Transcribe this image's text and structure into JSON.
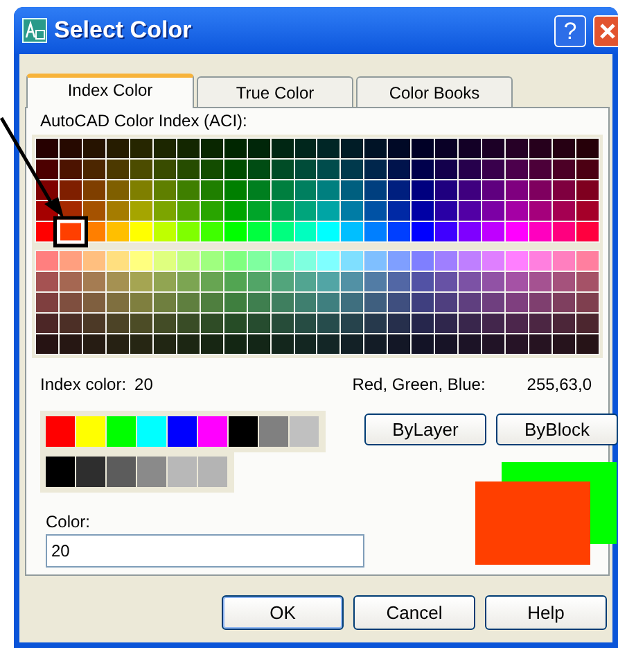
{
  "window": {
    "title": "Select Color",
    "help_button": "?"
  },
  "tabs": [
    {
      "label": "Index Color",
      "selected": true
    },
    {
      "label": "True Color",
      "selected": false
    },
    {
      "label": "Color Books",
      "selected": false
    }
  ],
  "aci_label": "AutoCAD Color Index (ACI):",
  "upper_rows": [
    {
      "swatches": [
        {
          "color": "#260000",
          "selected": false
        },
        {
          "color": "#260900",
          "selected": false
        },
        {
          "color": "#261300",
          "selected": false
        },
        {
          "color": "#261c00",
          "selected": false
        },
        {
          "color": "#262600",
          "selected": false
        },
        {
          "color": "#1c2600",
          "selected": false
        },
        {
          "color": "#132600",
          "selected": false
        },
        {
          "color": "#092600",
          "selected": false
        },
        {
          "color": "#002600",
          "selected": false
        },
        {
          "color": "#002609",
          "selected": false
        },
        {
          "color": "#002613",
          "selected": false
        },
        {
          "color": "#00261c",
          "selected": false
        },
        {
          "color": "#002626",
          "selected": false
        },
        {
          "color": "#001c26",
          "selected": false
        },
        {
          "color": "#001326",
          "selected": false
        },
        {
          "color": "#000926",
          "selected": false
        },
        {
          "color": "#000026",
          "selected": false
        },
        {
          "color": "#090026",
          "selected": false
        },
        {
          "color": "#130026",
          "selected": false
        },
        {
          "color": "#1c0026",
          "selected": false
        },
        {
          "color": "#260026",
          "selected": false
        },
        {
          "color": "#26001c",
          "selected": false
        },
        {
          "color": "#260013",
          "selected": false
        },
        {
          "color": "#260009",
          "selected": false
        }
      ]
    },
    {
      "swatches": [
        {
          "color": "#4c0000",
          "selected": false
        },
        {
          "color": "#4c1300",
          "selected": false
        },
        {
          "color": "#4c2600",
          "selected": false
        },
        {
          "color": "#4c3900",
          "selected": false
        },
        {
          "color": "#4c4c00",
          "selected": false
        },
        {
          "color": "#394c00",
          "selected": false
        },
        {
          "color": "#264c00",
          "selected": false
        },
        {
          "color": "#134c00",
          "selected": false
        },
        {
          "color": "#004c00",
          "selected": false
        },
        {
          "color": "#004c13",
          "selected": false
        },
        {
          "color": "#004c26",
          "selected": false
        },
        {
          "color": "#004c39",
          "selected": false
        },
        {
          "color": "#004c4c",
          "selected": false
        },
        {
          "color": "#00394c",
          "selected": false
        },
        {
          "color": "#00264c",
          "selected": false
        },
        {
          "color": "#00134c",
          "selected": false
        },
        {
          "color": "#00004c",
          "selected": false
        },
        {
          "color": "#13004c",
          "selected": false
        },
        {
          "color": "#26004c",
          "selected": false
        },
        {
          "color": "#39004c",
          "selected": false
        },
        {
          "color": "#4c004c",
          "selected": false
        },
        {
          "color": "#4c0039",
          "selected": false
        },
        {
          "color": "#4c0026",
          "selected": false
        },
        {
          "color": "#4c0013",
          "selected": false
        }
      ]
    },
    {
      "swatches": [
        {
          "color": "#7f0000",
          "selected": false
        },
        {
          "color": "#7f1f00",
          "selected": false
        },
        {
          "color": "#7f3f00",
          "selected": false
        },
        {
          "color": "#7f5f00",
          "selected": false
        },
        {
          "color": "#7f7f00",
          "selected": false
        },
        {
          "color": "#5f7f00",
          "selected": false
        },
        {
          "color": "#3f7f00",
          "selected": false
        },
        {
          "color": "#1f7f00",
          "selected": false
        },
        {
          "color": "#007f00",
          "selected": false
        },
        {
          "color": "#007f1f",
          "selected": false
        },
        {
          "color": "#007f3f",
          "selected": false
        },
        {
          "color": "#007f5f",
          "selected": false
        },
        {
          "color": "#007f7f",
          "selected": false
        },
        {
          "color": "#005f7f",
          "selected": false
        },
        {
          "color": "#003f7f",
          "selected": false
        },
        {
          "color": "#001f7f",
          "selected": false
        },
        {
          "color": "#00007f",
          "selected": false
        },
        {
          "color": "#1f007f",
          "selected": false
        },
        {
          "color": "#3f007f",
          "selected": false
        },
        {
          "color": "#5f007f",
          "selected": false
        },
        {
          "color": "#7f007f",
          "selected": false
        },
        {
          "color": "#7f005f",
          "selected": false
        },
        {
          "color": "#7f003f",
          "selected": false
        },
        {
          "color": "#7f001f",
          "selected": false
        }
      ]
    },
    {
      "swatches": [
        {
          "color": "#a50000",
          "selected": false
        },
        {
          "color": "#a52900",
          "selected": false
        },
        {
          "color": "#a55200",
          "selected": false
        },
        {
          "color": "#a57c00",
          "selected": false
        },
        {
          "color": "#a5a500",
          "selected": false
        },
        {
          "color": "#7ca500",
          "selected": false
        },
        {
          "color": "#52a500",
          "selected": false
        },
        {
          "color": "#29a500",
          "selected": false
        },
        {
          "color": "#00a500",
          "selected": false
        },
        {
          "color": "#00a529",
          "selected": false
        },
        {
          "color": "#00a552",
          "selected": false
        },
        {
          "color": "#00a57c",
          "selected": false
        },
        {
          "color": "#00a5a5",
          "selected": false
        },
        {
          "color": "#007ca5",
          "selected": false
        },
        {
          "color": "#0052a5",
          "selected": false
        },
        {
          "color": "#0029a5",
          "selected": false
        },
        {
          "color": "#0000a5",
          "selected": false
        },
        {
          "color": "#2900a5",
          "selected": false
        },
        {
          "color": "#5200a5",
          "selected": false
        },
        {
          "color": "#7c00a5",
          "selected": false
        },
        {
          "color": "#a500a5",
          "selected": false
        },
        {
          "color": "#a5007c",
          "selected": false
        },
        {
          "color": "#a50052",
          "selected": false
        },
        {
          "color": "#a50029",
          "selected": false
        }
      ]
    },
    {
      "swatches": [
        {
          "color": "#ff0000",
          "selected": false
        },
        {
          "color": "#ff3f00",
          "selected": true
        },
        {
          "color": "#ff7f00",
          "selected": false
        },
        {
          "color": "#ffbf00",
          "selected": false
        },
        {
          "color": "#ffff00",
          "selected": false
        },
        {
          "color": "#bfff00",
          "selected": false
        },
        {
          "color": "#7fff00",
          "selected": false
        },
        {
          "color": "#3fff00",
          "selected": false
        },
        {
          "color": "#00ff00",
          "selected": false
        },
        {
          "color": "#00ff3f",
          "selected": false
        },
        {
          "color": "#00ff7f",
          "selected": false
        },
        {
          "color": "#00ffbf",
          "selected": false
        },
        {
          "color": "#00ffff",
          "selected": false
        },
        {
          "color": "#00bfff",
          "selected": false
        },
        {
          "color": "#007fff",
          "selected": false
        },
        {
          "color": "#003fff",
          "selected": false
        },
        {
          "color": "#0000ff",
          "selected": false
        },
        {
          "color": "#3f00ff",
          "selected": false
        },
        {
          "color": "#7f00ff",
          "selected": false
        },
        {
          "color": "#bf00ff",
          "selected": false
        },
        {
          "color": "#ff00ff",
          "selected": false
        },
        {
          "color": "#ff00bf",
          "selected": false
        },
        {
          "color": "#ff007f",
          "selected": false
        },
        {
          "color": "#ff003f",
          "selected": false
        }
      ]
    }
  ],
  "lower_rows": [
    {
      "swatches": [
        {
          "color": "#ff7f7f",
          "selected": false
        },
        {
          "color": "#ff9f7f",
          "selected": false
        },
        {
          "color": "#ffbf7f",
          "selected": false
        },
        {
          "color": "#ffdf7f",
          "selected": false
        },
        {
          "color": "#ffff7f",
          "selected": false
        },
        {
          "color": "#dfff7f",
          "selected": false
        },
        {
          "color": "#bfff7f",
          "selected": false
        },
        {
          "color": "#9fff7f",
          "selected": false
        },
        {
          "color": "#7fff7f",
          "selected": false
        },
        {
          "color": "#7fff9f",
          "selected": false
        },
        {
          "color": "#7fffbf",
          "selected": false
        },
        {
          "color": "#7fffdf",
          "selected": false
        },
        {
          "color": "#7fffff",
          "selected": false
        },
        {
          "color": "#7fdfff",
          "selected": false
        },
        {
          "color": "#7fbfff",
          "selected": false
        },
        {
          "color": "#7f9fff",
          "selected": false
        },
        {
          "color": "#7f7fff",
          "selected": false
        },
        {
          "color": "#9f7fff",
          "selected": false
        },
        {
          "color": "#bf7fff",
          "selected": false
        },
        {
          "color": "#df7fff",
          "selected": false
        },
        {
          "color": "#ff7fff",
          "selected": false
        },
        {
          "color": "#ff7fdf",
          "selected": false
        },
        {
          "color": "#ff7fbf",
          "selected": false
        },
        {
          "color": "#ff7f9f",
          "selected": false
        }
      ]
    },
    {
      "swatches": [
        {
          "color": "#a55252",
          "selected": false
        },
        {
          "color": "#a56752",
          "selected": false
        },
        {
          "color": "#a57c52",
          "selected": false
        },
        {
          "color": "#a59152",
          "selected": false
        },
        {
          "color": "#a5a552",
          "selected": false
        },
        {
          "color": "#91a552",
          "selected": false
        },
        {
          "color": "#7ca552",
          "selected": false
        },
        {
          "color": "#67a552",
          "selected": false
        },
        {
          "color": "#52a552",
          "selected": false
        },
        {
          "color": "#52a567",
          "selected": false
        },
        {
          "color": "#52a57c",
          "selected": false
        },
        {
          "color": "#52a591",
          "selected": false
        },
        {
          "color": "#52a5a5",
          "selected": false
        },
        {
          "color": "#5291a5",
          "selected": false
        },
        {
          "color": "#527ca5",
          "selected": false
        },
        {
          "color": "#5267a5",
          "selected": false
        },
        {
          "color": "#5252a5",
          "selected": false
        },
        {
          "color": "#6752a5",
          "selected": false
        },
        {
          "color": "#7c52a5",
          "selected": false
        },
        {
          "color": "#9152a5",
          "selected": false
        },
        {
          "color": "#a552a5",
          "selected": false
        },
        {
          "color": "#a55291",
          "selected": false
        },
        {
          "color": "#a5527c",
          "selected": false
        },
        {
          "color": "#a55267",
          "selected": false
        }
      ]
    },
    {
      "swatches": [
        {
          "color": "#7f3f3f",
          "selected": false
        },
        {
          "color": "#7f4f3f",
          "selected": false
        },
        {
          "color": "#7f5f3f",
          "selected": false
        },
        {
          "color": "#7f6f3f",
          "selected": false
        },
        {
          "color": "#7f7f3f",
          "selected": false
        },
        {
          "color": "#6f7f3f",
          "selected": false
        },
        {
          "color": "#5f7f3f",
          "selected": false
        },
        {
          "color": "#4f7f3f",
          "selected": false
        },
        {
          "color": "#3f7f3f",
          "selected": false
        },
        {
          "color": "#3f7f4f",
          "selected": false
        },
        {
          "color": "#3f7f5f",
          "selected": false
        },
        {
          "color": "#3f7f6f",
          "selected": false
        },
        {
          "color": "#3f7f7f",
          "selected": false
        },
        {
          "color": "#3f6f7f",
          "selected": false
        },
        {
          "color": "#3f5f7f",
          "selected": false
        },
        {
          "color": "#3f4f7f",
          "selected": false
        },
        {
          "color": "#3f3f7f",
          "selected": false
        },
        {
          "color": "#4f3f7f",
          "selected": false
        },
        {
          "color": "#5f3f7f",
          "selected": false
        },
        {
          "color": "#6f3f7f",
          "selected": false
        },
        {
          "color": "#7f3f7f",
          "selected": false
        },
        {
          "color": "#7f3f6f",
          "selected": false
        },
        {
          "color": "#7f3f5f",
          "selected": false
        },
        {
          "color": "#7f3f4f",
          "selected": false
        }
      ]
    },
    {
      "swatches": [
        {
          "color": "#4c2626",
          "selected": false
        },
        {
          "color": "#4c2f26",
          "selected": false
        },
        {
          "color": "#4c3926",
          "selected": false
        },
        {
          "color": "#4c4326",
          "selected": false
        },
        {
          "color": "#4c4c26",
          "selected": false
        },
        {
          "color": "#434c26",
          "selected": false
        },
        {
          "color": "#394c26",
          "selected": false
        },
        {
          "color": "#2f4c26",
          "selected": false
        },
        {
          "color": "#264c26",
          "selected": false
        },
        {
          "color": "#264c2f",
          "selected": false
        },
        {
          "color": "#264c39",
          "selected": false
        },
        {
          "color": "#264c43",
          "selected": false
        },
        {
          "color": "#264c4c",
          "selected": false
        },
        {
          "color": "#26434c",
          "selected": false
        },
        {
          "color": "#26394c",
          "selected": false
        },
        {
          "color": "#262f4c",
          "selected": false
        },
        {
          "color": "#26264c",
          "selected": false
        },
        {
          "color": "#2f264c",
          "selected": false
        },
        {
          "color": "#39264c",
          "selected": false
        },
        {
          "color": "#43264c",
          "selected": false
        },
        {
          "color": "#4c264c",
          "selected": false
        },
        {
          "color": "#4c2643",
          "selected": false
        },
        {
          "color": "#4c2639",
          "selected": false
        },
        {
          "color": "#4c262f",
          "selected": false
        }
      ]
    },
    {
      "swatches": [
        {
          "color": "#261313",
          "selected": false
        },
        {
          "color": "#261713",
          "selected": false
        },
        {
          "color": "#261c13",
          "selected": false
        },
        {
          "color": "#262113",
          "selected": false
        },
        {
          "color": "#262613",
          "selected": false
        },
        {
          "color": "#212613",
          "selected": false
        },
        {
          "color": "#1c2613",
          "selected": false
        },
        {
          "color": "#172613",
          "selected": false
        },
        {
          "color": "#132613",
          "selected": false
        },
        {
          "color": "#132617",
          "selected": false
        },
        {
          "color": "#13261c",
          "selected": false
        },
        {
          "color": "#132621",
          "selected": false
        },
        {
          "color": "#132626",
          "selected": false
        },
        {
          "color": "#132126",
          "selected": false
        },
        {
          "color": "#131c26",
          "selected": false
        },
        {
          "color": "#131726",
          "selected": false
        },
        {
          "color": "#131326",
          "selected": false
        },
        {
          "color": "#171326",
          "selected": false
        },
        {
          "color": "#1c1326",
          "selected": false
        },
        {
          "color": "#211326",
          "selected": false
        },
        {
          "color": "#261326",
          "selected": false
        },
        {
          "color": "#261321",
          "selected": false
        },
        {
          "color": "#26131c",
          "selected": false
        },
        {
          "color": "#261317",
          "selected": false
        }
      ]
    }
  ],
  "index_color": {
    "label": "Index color:",
    "value": "20"
  },
  "rgb": {
    "label": "Red, Green, Blue:",
    "value": "255,63,0"
  },
  "standard_colors": [
    {
      "color": "#ff0000",
      "selected": false
    },
    {
      "color": "#ffff00",
      "selected": false
    },
    {
      "color": "#00ff00",
      "selected": false
    },
    {
      "color": "#00ffff",
      "selected": false
    },
    {
      "color": "#0000ff",
      "selected": false
    },
    {
      "color": "#ff00ff",
      "selected": false
    },
    {
      "color": "#000000",
      "selected": false
    },
    {
      "color": "#808080",
      "selected": false
    },
    {
      "color": "#c0c0c0",
      "selected": false
    }
  ],
  "gray_colors": [
    {
      "color": "#000000",
      "selected": false
    },
    {
      "color": "#2e2e2e",
      "selected": false
    },
    {
      "color": "#5c5c5c",
      "selected": false
    },
    {
      "color": "#8a8a8a",
      "selected": false
    },
    {
      "color": "#b8b8b8",
      "selected": false
    },
    {
      "color": "#b4b4b4",
      "selected": false
    }
  ],
  "by_buttons": [
    "ByLayer",
    "ByBlock"
  ],
  "color_field": {
    "label": "Color:",
    "value": "20"
  },
  "preview": [
    {
      "kind": "old",
      "color": "#00ff00"
    },
    {
      "kind": "new",
      "color": "#ff3f00"
    }
  ],
  "buttons": [
    "OK",
    "Cancel",
    "Help"
  ]
}
